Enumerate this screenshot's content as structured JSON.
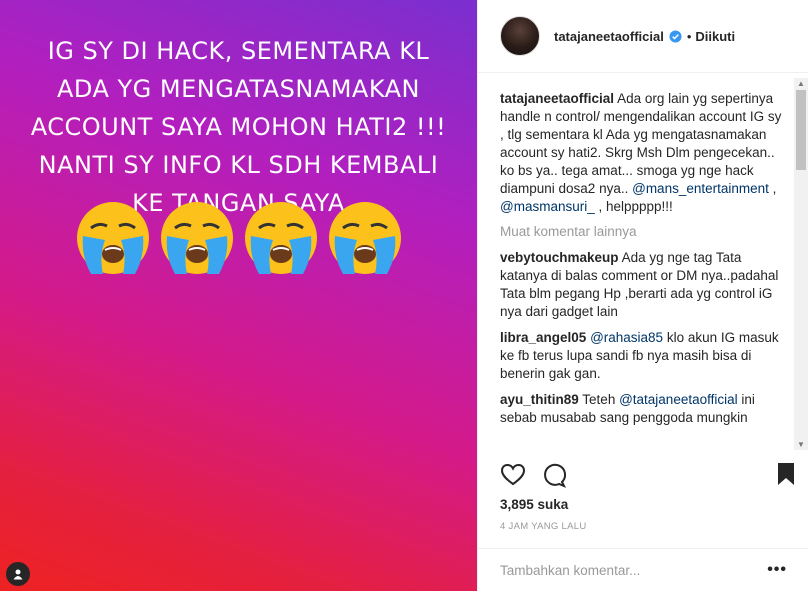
{
  "post_image": {
    "text": "IG SY DI HACK, SEMENTARA KL ADA YG MENGATASNAMAKAN ACCOUNT SAYA MOHON HATI2 !!! NANTI SY INFO KL SDH KEMBALI KE TANGAN SAYA",
    "emojis": [
      "crying-face-icon",
      "crying-face-icon",
      "crying-face-icon",
      "crying-face-icon"
    ]
  },
  "header": {
    "username": "tatajaneetaofficial",
    "separator": "•",
    "follow_status": "Diikuti"
  },
  "caption": {
    "username": "tatajaneetaofficial",
    "text": "Ada org lain yg sepertinya handle n control/ mengendalikan account IG sy , tlg sementara kl Ada yg mengatasnamakan account sy hati2. Skrg Msh Dlm pengecekan.. ko bs ya.. tega amat... smoga yg nge hack diampuni dosa2 nya..",
    "mention1": "@mans_entertainment",
    "sep": " , ",
    "mention2": "@masmansuri_",
    "tail": " , helppppp!!!"
  },
  "load_more": "Muat komentar lainnya",
  "comments": [
    {
      "username": "vebytouchmakeup",
      "text": "Ada yg nge tag Tata katanya di balas comment or DM nya..padahal Tata blm pegang Hp ,berarti ada yg control iG nya dari gadget lain"
    },
    {
      "username": "libra_angel05",
      "mention": "@rahasia85",
      "text": " klo akun IG masuk ke fb terus lupa sandi fb nya masih bisa di benerin gak gan."
    },
    {
      "username": "ayu_thitin89",
      "pre": "Teteh ",
      "mention": "@tatajaneetaofficial",
      "text": " ini sebab musabab sang penggoda mungkin"
    }
  ],
  "likes": "3,895 suka",
  "timestamp": "4 JAM YANG LALU",
  "add_comment_placeholder": "Tambahkan komentar...",
  "more_options": "•••"
}
